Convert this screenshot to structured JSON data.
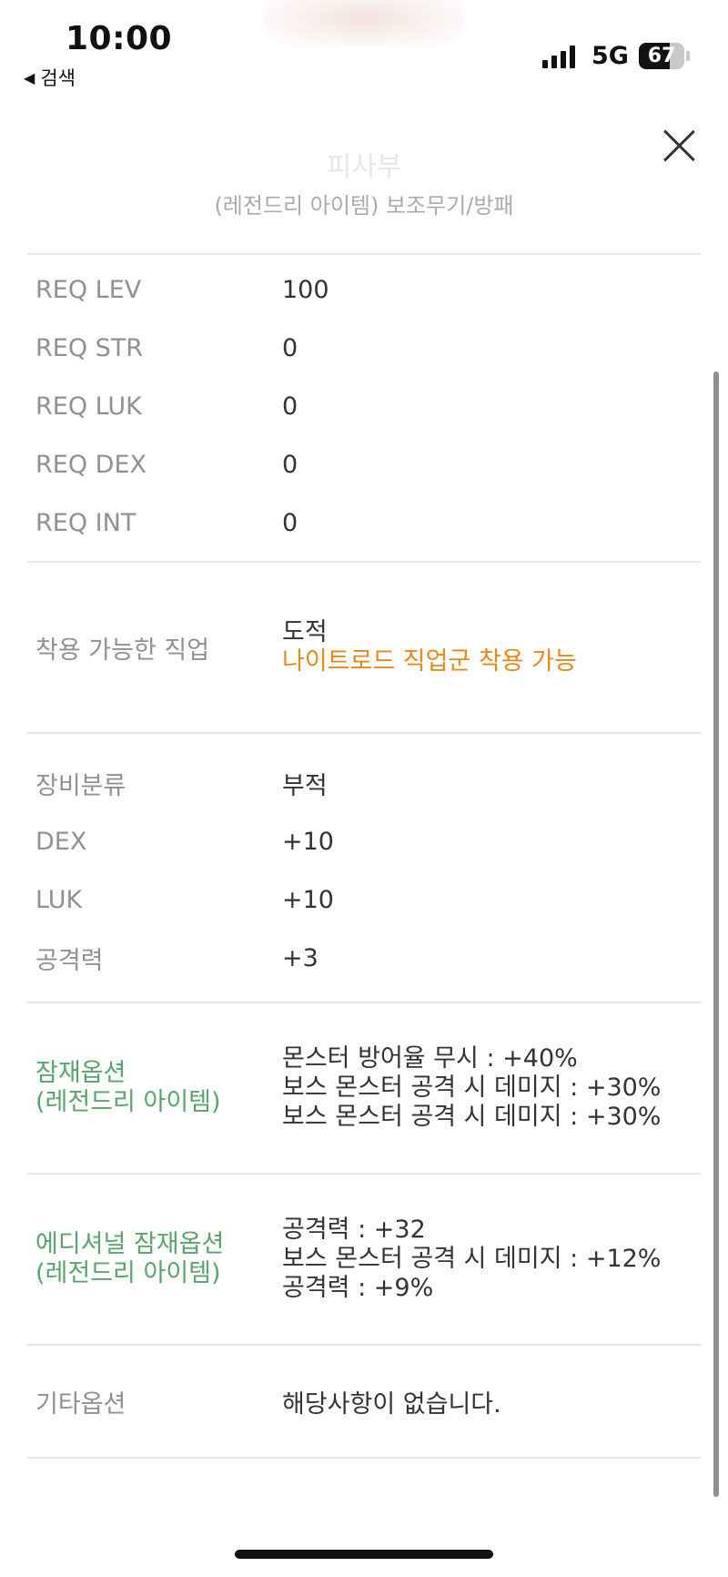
{
  "status_bar": {
    "time": "10:00",
    "back_label": "검색",
    "network": "5G",
    "battery": "67",
    "battery_level": 0.67
  },
  "header": {
    "item_name": "피사부",
    "item_category": "(레전드리 아이템) 보조무기/방패"
  },
  "requirements": [
    {
      "label": "REQ LEV",
      "value": "100"
    },
    {
      "label": "REQ STR",
      "value": "0"
    },
    {
      "label": "REQ LUK",
      "value": "0"
    },
    {
      "label": "REQ DEX",
      "value": "0"
    },
    {
      "label": "REQ INT",
      "value": "0"
    }
  ],
  "jobs": {
    "label": "착용 가능한 직업",
    "job": "도적",
    "note": "나이트로드 직업군 착용 가능"
  },
  "stats": [
    {
      "label": "장비분류",
      "value": "부적"
    },
    {
      "label": "DEX",
      "value": "+10"
    },
    {
      "label": "LUK",
      "value": "+10"
    },
    {
      "label": "공격력",
      "value": "+3"
    }
  ],
  "potential": {
    "label_line1": "잠재옵션",
    "label_line2": "(레전드리 아이템)",
    "lines": [
      "몬스터 방어율 무시 : +40%",
      "보스 몬스터 공격 시 데미지 : +30%",
      "보스 몬스터 공격 시 데미지 : +30%"
    ]
  },
  "additional_potential": {
    "label_line1": "에디셔널 잠재옵션",
    "label_line2": "(레전드리 아이템)",
    "lines": [
      "공격력 : +32",
      "보스 몬스터 공격 시 데미지 : +12%",
      "공격력 : +9%"
    ]
  },
  "other": {
    "label": "기타옵션",
    "value": "해당사항이 없습니다."
  },
  "colors": {
    "label_gray": "#8e9196",
    "value_dark": "#333333",
    "potential_green": "#5aa46d",
    "job_orange": "#e38a1c",
    "divider": "#e6e6e6"
  }
}
